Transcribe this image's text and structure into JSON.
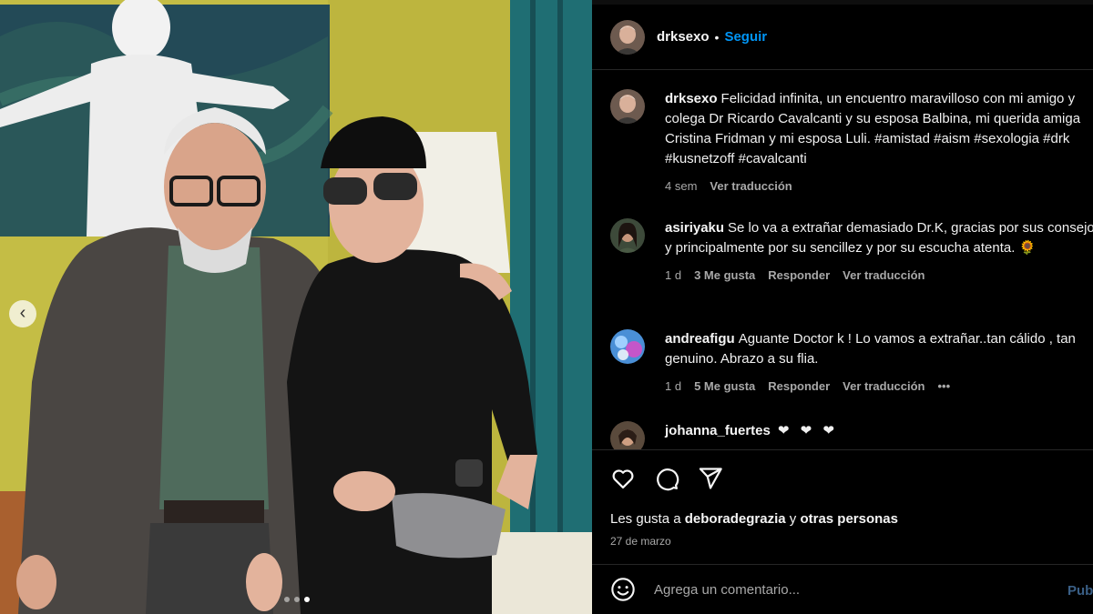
{
  "post": {
    "username": "drksexo",
    "bullet": "•",
    "follow_label": "Seguir",
    "caption": "Felicidad infinita, un encuentro maravilloso con mi amigo y colega Dr Ricardo Cavalcanti y su esposa Balbina, mi querida amiga Cristina Fridman y mi esposa Luli. #amistad #aism #sexologia #drk #kusnetzoff #cavalcanti",
    "caption_age": "4 sem",
    "caption_translate": "Ver traducción"
  },
  "photo": {
    "prev_icon": "‹",
    "dots_count": 3,
    "active_dot": 3
  },
  "comments": [
    {
      "username": "asiriyaku",
      "text": "Se lo va a extrañar demasiado Dr.K, gracias por sus consejos y principalmente por su sencillez y por su escucha atenta. 🌻",
      "age": "1 d",
      "likes": "3 Me gusta",
      "reply": "Responder",
      "translate": "Ver traducción"
    },
    {
      "username": "andreafigu",
      "text": "Aguante Doctor k ! Lo vamos a extrañar..tan cálido , tan genuino. Abrazo a su flia.",
      "age": "1 d",
      "likes": "5 Me gusta",
      "reply": "Responder",
      "translate": "Ver traducción",
      "more": "•••"
    },
    {
      "username": "johanna_fuertes",
      "text": "❤ ❤ ❤"
    }
  ],
  "likes_line": {
    "prefix": "Les gusta a",
    "user": "deboradegrazia",
    "joiner": "y",
    "others": "otras personas"
  },
  "date": "27 de marzo",
  "comment_box": {
    "placeholder": "Agrega un comentario...",
    "publish": "Pub"
  },
  "icons": {
    "like": "heart-icon",
    "comment": "comment-icon",
    "share": "paper-plane-icon",
    "emoji": "emoji-icon"
  },
  "colors": {
    "background": "#000000",
    "link_blue": "#0095f6",
    "muted_text": "#a8a8a8",
    "heart_red": "#ff3040"
  }
}
